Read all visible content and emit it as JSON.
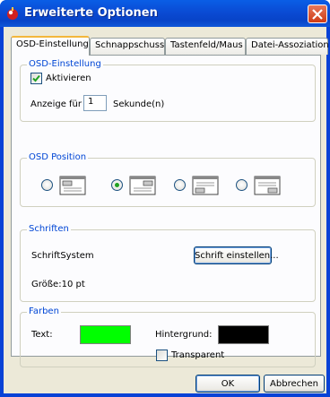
{
  "window": {
    "title": "Erweiterte Optionen"
  },
  "tabs": [
    {
      "label": "OSD-Einstellung"
    },
    {
      "label": "Schnappschuss"
    },
    {
      "label": "Tastenfeld/Maus"
    },
    {
      "label": "Datei-Assoziation"
    }
  ],
  "osd_settings": {
    "title": "OSD-Einstellung",
    "enable_label": "Aktivieren",
    "enable_checked": true,
    "display_for_label": "Anzeige für",
    "display_for_value": "1",
    "seconds_label": "Sekunde(n)"
  },
  "osd_position": {
    "title": "OSD Position",
    "options": [
      {
        "icon": "position-top-left-icon",
        "selected": false
      },
      {
        "icon": "position-top-right-icon",
        "selected": true
      },
      {
        "icon": "position-bottom-left-icon",
        "selected": false
      },
      {
        "icon": "position-bottom-right-icon",
        "selected": false
      }
    ]
  },
  "fonts": {
    "title": "Schriften",
    "font_name": "SchriftSystem",
    "set_font_button": "Schrift einstellen...",
    "size_label": "Größe:10 pt"
  },
  "colors": {
    "title": "Farben",
    "text_label": "Text:",
    "text_color": "#00ff00",
    "background_label": "Hintergrund:",
    "background_color": "#000000",
    "transparent_label": "Transparent",
    "transparent_checked": false
  },
  "footer": {
    "ok_label": "OK",
    "cancel_label": "Abbrechen"
  }
}
